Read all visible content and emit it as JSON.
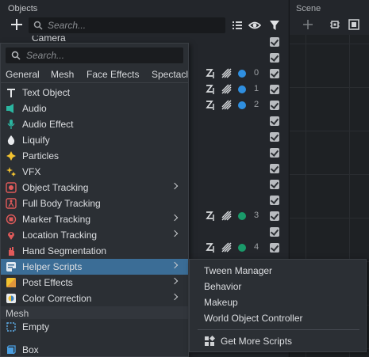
{
  "objects_panel": {
    "title": "Objects",
    "search_placeholder": "Search...",
    "partial_row_label": "Camera"
  },
  "scene_panel": {
    "title": "Scene"
  },
  "object_rows": [
    {
      "has_layer": false
    },
    {
      "has_layer": false
    },
    {
      "has_layer": true,
      "layer": "0",
      "dot_color": "#2f8fe0"
    },
    {
      "has_layer": true,
      "layer": "1",
      "dot_color": "#2f8fe0"
    },
    {
      "has_layer": true,
      "layer": "2",
      "dot_color": "#2f8fe0"
    },
    {
      "has_layer": false
    },
    {
      "has_layer": false
    },
    {
      "has_layer": false
    },
    {
      "has_layer": false
    },
    {
      "has_layer": false
    },
    {
      "has_layer": false
    },
    {
      "has_layer": true,
      "layer": "3",
      "dot_color": "#1a9a6a"
    },
    {
      "has_layer": false
    },
    {
      "has_layer": true,
      "layer": "4",
      "dot_color": "#1a9a6a"
    }
  ],
  "add_menu": {
    "search_placeholder": "Search...",
    "tabs": [
      "General",
      "Mesh",
      "Face Effects",
      "Spectacles"
    ],
    "items": [
      {
        "label": "Text Object",
        "icon": "text-icon",
        "submenu": false
      },
      {
        "label": "Audio",
        "icon": "audio-icon",
        "submenu": false
      },
      {
        "label": "Audio Effect",
        "icon": "microphone-icon",
        "submenu": false
      },
      {
        "label": "Liquify",
        "icon": "droplet-icon",
        "submenu": false
      },
      {
        "label": "Particles",
        "icon": "particles-icon",
        "submenu": false
      },
      {
        "label": "VFX",
        "icon": "sparkle-icon",
        "submenu": false
      },
      {
        "label": "Object Tracking",
        "icon": "object-tracking-icon",
        "submenu": true
      },
      {
        "label": "Full Body Tracking",
        "icon": "body-tracking-icon",
        "submenu": false
      },
      {
        "label": "Marker Tracking",
        "icon": "marker-tracking-icon",
        "submenu": true
      },
      {
        "label": "Location Tracking",
        "icon": "location-pin-icon",
        "submenu": true
      },
      {
        "label": "Hand Segmentation",
        "icon": "hand-icon",
        "submenu": false
      },
      {
        "label": "Helper Scripts",
        "icon": "script-icon",
        "submenu": true,
        "selected": true
      },
      {
        "label": "Post Effects",
        "icon": "post-effects-icon",
        "submenu": true
      },
      {
        "label": "Color Correction",
        "icon": "color-correction-icon",
        "submenu": true
      }
    ],
    "mesh_section": "Mesh",
    "mesh_items": [
      {
        "label": "Empty",
        "icon": "empty-icon"
      },
      {
        "label": "Box",
        "icon": "box-icon"
      }
    ]
  },
  "submenu": {
    "items": [
      "Tween Manager",
      "Behavior",
      "Makeup",
      "World Object Controller"
    ],
    "more_label": "Get More Scripts"
  },
  "colors": {
    "accent": "#3b6d96",
    "blue_dot": "#2f8fe0",
    "green_dot": "#1a9a6a"
  }
}
